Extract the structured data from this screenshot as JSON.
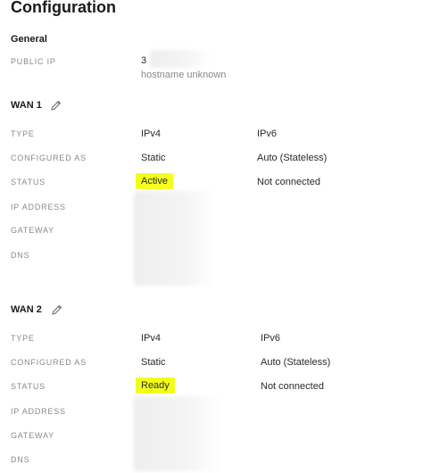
{
  "page": {
    "title": "Configuration"
  },
  "general": {
    "title": "General",
    "public_ip_label": "PUBLIC IP",
    "public_ip_value": "3",
    "hostname": "hostname unknown"
  },
  "wan1": {
    "title": "WAN 1",
    "rows": {
      "type_label": "TYPE",
      "configured_as_label": "CONFIGURED AS",
      "status_label": "STATUS",
      "ip_address_label": "IP ADDRESS",
      "gateway_label": "GATEWAY",
      "dns_label": "DNS"
    },
    "ipv4": {
      "type": "IPv4",
      "configured_as": "Static",
      "status": "Active"
    },
    "ipv6": {
      "type": "IPv6",
      "configured_as": "Auto (Stateless)",
      "status": "Not connected"
    }
  },
  "wan2": {
    "title": "WAN 2",
    "rows": {
      "type_label": "TYPE",
      "configured_as_label": "CONFIGURED AS",
      "status_label": "STATUS",
      "ip_address_label": "IP ADDRESS",
      "gateway_label": "GATEWAY",
      "dns_label": "DNS"
    },
    "ipv4": {
      "type": "IPv4",
      "configured_as": "Static",
      "status": "Ready"
    },
    "ipv6": {
      "type": "IPv6",
      "configured_as": "Auto (Stateless)",
      "status": "Not connected"
    }
  },
  "colors": {
    "highlight": "#f4ff1a",
    "label": "#8a8a8a"
  },
  "icons": {
    "edit": "pencil-icon"
  }
}
